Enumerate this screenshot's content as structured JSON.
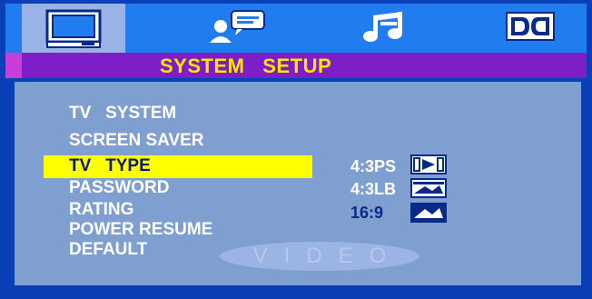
{
  "tabs": [
    {
      "name": "system-setup-tab",
      "icon": "tv-monitor-icon",
      "active": true
    },
    {
      "name": "language-setup-tab",
      "icon": "speaker-person-icon",
      "active": false
    },
    {
      "name": "audio-setup-tab",
      "icon": "music-note-icon",
      "active": false
    },
    {
      "name": "dolby-setup-tab",
      "icon": "dolby-icon",
      "active": false
    }
  ],
  "title": "SYSTEM   SETUP",
  "menu": {
    "items": [
      {
        "label": "TV   SYSTEM",
        "selected": false
      },
      {
        "label": "SCREEN SAVER",
        "selected": false
      },
      {
        "label": "TV   TYPE",
        "selected": true
      },
      {
        "label": "PASSWORD",
        "selected": false
      },
      {
        "label": "RATING",
        "selected": false
      },
      {
        "label": "POWER RESUME",
        "selected": false
      },
      {
        "label": "DEFAULT",
        "selected": false
      }
    ]
  },
  "options": [
    {
      "label": "4:3PS",
      "icon": "aspect-4-3-panscan-icon",
      "current": false
    },
    {
      "label": "4:3LB",
      "icon": "aspect-4-3-letterbox-icon",
      "current": false
    },
    {
      "label": "16:9",
      "icon": "aspect-16-9-widescreen-icon",
      "current": true
    }
  ],
  "watermark": "VIDEO",
  "colors": {
    "background": "#0a3fb8",
    "tabbar": "#1f7df0",
    "titlebar": "#7d1ec9",
    "title_text": "#ffe600",
    "panel": "#7f9fd0",
    "highlight": "#ffff00"
  }
}
